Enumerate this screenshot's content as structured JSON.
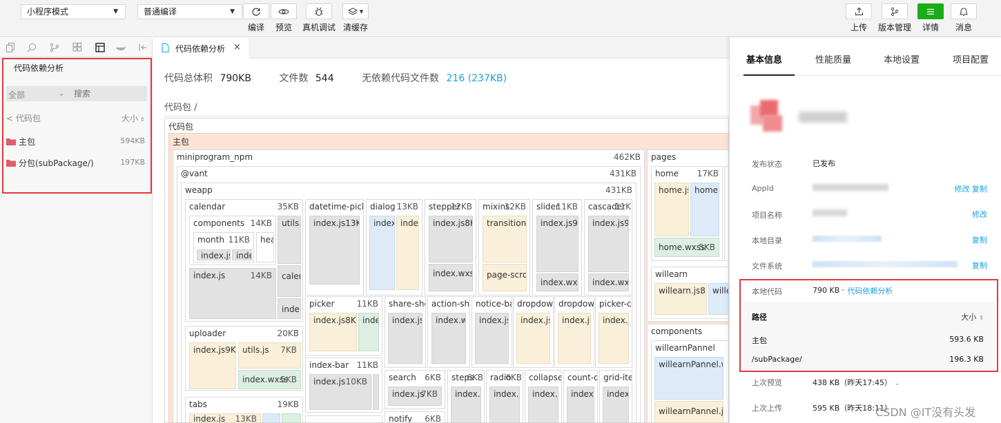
{
  "toolbar": {
    "mode_select": "小程序模式",
    "compile_select": "普通编译",
    "buttons": [
      {
        "label": "编译",
        "icon": "refresh-icon"
      },
      {
        "label": "预览",
        "icon": "eye-icon"
      },
      {
        "label": "真机调试",
        "icon": "bug-icon"
      },
      {
        "label": "清缓存",
        "icon": "layers-icon"
      }
    ],
    "right_buttons": [
      {
        "label": "上传",
        "icon": "upload-icon"
      },
      {
        "label": "版本管理",
        "icon": "branch-icon"
      },
      {
        "label": "详情",
        "icon": "menu-icon"
      },
      {
        "label": "消息",
        "icon": "bell-icon"
      }
    ]
  },
  "sidebar": {
    "title": "代码依赖分析",
    "filter_select": "全部",
    "search_placeholder": "搜索",
    "back_label": "< 代码包",
    "sort_label": "大小",
    "packages": [
      {
        "name": "主包",
        "size": "594KB"
      },
      {
        "name": "分包(subPackage/)",
        "size": "197KB"
      }
    ]
  },
  "tab": {
    "label": "代码依赖分析",
    "close": "×"
  },
  "summary": {
    "total_label": "代码总体积",
    "total_value": "790KB",
    "files_label": "文件数",
    "files_value": "544",
    "nodep_label": "无依赖代码文件数",
    "nodep_value": "216 (237KB)"
  },
  "breadcrumb": "代码包 /",
  "treemap": {
    "root": "代码包",
    "main": "主包",
    "npm": {
      "name": "miniprogram_npm",
      "size": "462KB"
    },
    "vant": {
      "name": "@vant",
      "size": "431KB"
    },
    "weapp": {
      "name": "weapp",
      "size": "431KB"
    },
    "calendar": {
      "name": "calendar",
      "size": "35KB"
    },
    "components": {
      "name": "components",
      "size": "14KB"
    },
    "month": {
      "name": "month",
      "size": "11KB"
    },
    "cal_index": {
      "name": "index.js",
      "size": "14KB"
    },
    "utils": "utils.",
    "cale": "caler",
    "inde": "inde",
    "idx_js_small": "index.js",
    "idx_small": "inde",
    "hea": "hea",
    "datetime": {
      "name": "datetime-picke",
      "file": "index.js",
      "fsize": "13KB"
    },
    "dialog": {
      "name": "dialog",
      "size": "13KB",
      "f1": "index.",
      "f2": "index"
    },
    "stepper": {
      "name": "stepper",
      "size": "12KB",
      "f1": "index.js",
      "f1s": "8KB",
      "f2": "index.wxss"
    },
    "mixins": {
      "name": "mixins",
      "size": "12KB",
      "f1": "transition.j",
      "f2": "page-scrol"
    },
    "slider": {
      "name": "slider",
      "size": "11KB",
      "f1": "index.js",
      "f1s": "9K",
      "f2": "index.wxm"
    },
    "cascader": {
      "name": "cascader",
      "size": "11K",
      "f1": "index.js",
      "f1s": "9K",
      "f2": "index.wxm"
    },
    "uploader": {
      "name": "uploader",
      "size": "20KB",
      "f1": "index.js",
      "f1s": "9KB",
      "f2": "utils.js",
      "f2s": "7KB",
      "f3": "index.wxss",
      "f3s": "5KB"
    },
    "picker": {
      "name": "picker",
      "size": "11KB",
      "f1": "index.js",
      "f1s": "8KB",
      "f2": "inde"
    },
    "share": {
      "name": "share-shee",
      "f": "index.js"
    },
    "action": {
      "name": "action-she",
      "f": "index.w"
    },
    "notice": {
      "name": "notice-ba",
      "f": "index.js"
    },
    "dropdown1": {
      "name": "dropdow",
      "f": "index.js"
    },
    "dropdown2": {
      "name": "dropdow",
      "f": "index.js"
    },
    "pickerco": {
      "name": "picker-co",
      "f": "index.js"
    },
    "indexbar": {
      "name": "index-bar",
      "size": "11KB",
      "f": "index.js",
      "fs": "10KB"
    },
    "search": {
      "name": "search",
      "size": "6KB",
      "f": "index.js",
      "fs": "7KB"
    },
    "steps": {
      "name": "steps",
      "size": "6KB",
      "f": "index.w"
    },
    "radio": {
      "name": "radio",
      "size": "6KB",
      "f": "index.j"
    },
    "collapse": {
      "name": "collapse-",
      "f": "index.j"
    },
    "countdown": {
      "name": "count-do",
      "f": "index.j"
    },
    "griditem": {
      "name": "grid-iter",
      "f": "index."
    },
    "tabs": {
      "name": "tabs",
      "size": "19KB",
      "f1": "index.js",
      "f1s": "13KB"
    },
    "notify": {
      "name": "notify",
      "size": "6KB"
    },
    "pages": "pages",
    "home": {
      "name": "home",
      "size": "17KB",
      "f1": "home.js",
      "f2": "home.",
      "f3": "home.wxss",
      "f3s": "5KB"
    },
    "willearn": {
      "name": "willearn",
      "f1": "willearn.js",
      "f1s": "8KB",
      "f2": "wille"
    },
    "components2": "components",
    "willearnPannel": {
      "name": "willearnPannel",
      "f1": "willearnPannel.wx",
      "f2": "willearnPannel.js"
    }
  },
  "panel": {
    "tabs": [
      "基本信息",
      "性能质量",
      "本地设置",
      "项目配置"
    ],
    "rows": [
      {
        "label": "发布状态",
        "value": "已发布"
      },
      {
        "label": "AppId",
        "action": "修改 复制"
      },
      {
        "label": "项目名称",
        "action": "修改"
      },
      {
        "label": "本地目录",
        "action": "复制"
      },
      {
        "label": "文件系统",
        "action": "复制"
      }
    ],
    "local_code": {
      "label": "本地代码",
      "value": "790 KB",
      "link": "代码依赖分析"
    },
    "path_table": {
      "header": "路径",
      "sort": "大小",
      "rows": [
        {
          "path": "主包",
          "size": "593.6 KB"
        },
        {
          "path": "/subPackage/",
          "size": "196.3 KB"
        }
      ]
    },
    "last_preview": {
      "label": "上次预览",
      "value": "438 KB（昨天17:45）"
    },
    "last_upload": {
      "label": "上次上传",
      "value": "595 KB（昨天18:11）"
    }
  },
  "watermark": "CSDN @IT没有头发",
  "colors": {
    "accent": "#1aad19",
    "link": "#1aa0e0",
    "highlight": "#e0383c"
  }
}
